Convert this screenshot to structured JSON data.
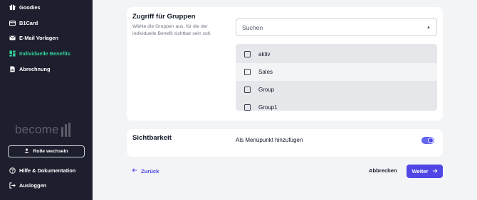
{
  "sidebar": {
    "items": [
      {
        "label": "Goodies",
        "icon": "gift-icon"
      },
      {
        "label": "B1Card",
        "icon": "card-icon"
      },
      {
        "label": "E-Mail Vorlagen",
        "icon": "mail-icon"
      },
      {
        "label": "Individuelle Benefits",
        "icon": "grid-icon",
        "active": true
      },
      {
        "label": "Abrechnung",
        "icon": "document-icon"
      }
    ],
    "logo_text": "become",
    "role_button": "Rolle wechseln",
    "help": "Hilfe & Dokumentation",
    "logout": "Ausloggen",
    "accent_color": "#34d399",
    "background": "#1d1f2e"
  },
  "groups": {
    "title": "Zugriff für Gruppen",
    "description": "Wähle die Gruppen aus, für die der individuelle Benefit sichtbar sein soll.",
    "search_value": "Suchen",
    "options": [
      {
        "label": "aktiv",
        "checked": false
      },
      {
        "label": "Sales",
        "checked": false
      },
      {
        "label": "Group",
        "checked": false
      },
      {
        "label": "Group1",
        "checked": false
      }
    ]
  },
  "visibility": {
    "title": "Sichtbarkeit",
    "option_label": "Als Menüpunkt hinzufügen",
    "toggle_on": true
  },
  "footer": {
    "back": "Zurück",
    "cancel": "Abbrechen",
    "next": "Weiter",
    "primary_color": "#4f46e5"
  }
}
